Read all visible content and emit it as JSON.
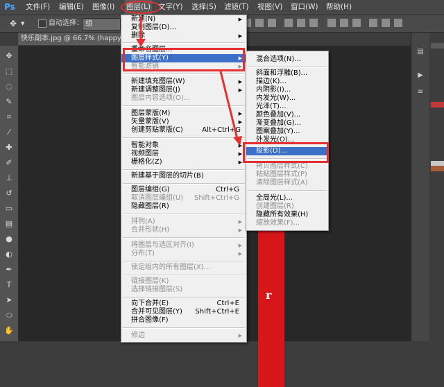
{
  "menubar": {
    "logo": "Ps",
    "items": [
      {
        "label": "文件(F)"
      },
      {
        "label": "编辑(E)"
      },
      {
        "label": "图像(I)"
      },
      {
        "label": "图层(L)"
      },
      {
        "label": "文字(Y)"
      },
      {
        "label": "选择(S)"
      },
      {
        "label": "滤镜(T)"
      },
      {
        "label": "视图(V)"
      },
      {
        "label": "窗口(W)"
      },
      {
        "label": "帮助(H)"
      }
    ]
  },
  "options_bar": {
    "auto_select_label": "自动选择：",
    "auto_select_value": "组"
  },
  "document_tab": {
    "title": "快乐副本.jpg @ 66.7% (happy"
  },
  "layer_menu": {
    "items": [
      {
        "label": "新建(N)",
        "arrow": "▶"
      },
      {
        "label": "复制图层(D)..."
      },
      {
        "label": "删除",
        "arrow": "▶"
      },
      {
        "label": "重命名图层..."
      },
      {
        "label": "图层样式(Y)",
        "arrow": "▶"
      },
      {
        "label": "智能滤镜",
        "arrow": "▶"
      },
      {
        "label": "新建填充图层(W)",
        "arrow": "▶"
      },
      {
        "label": "新建调整图层(J)",
        "arrow": "▶"
      },
      {
        "label": "图层内容选项(O)..."
      },
      {
        "label": "图层蒙版(M)",
        "arrow": "▶"
      },
      {
        "label": "矢量蒙版(V)",
        "arrow": "▶"
      },
      {
        "label": "创建剪贴蒙版(C)",
        "shortcut": "Alt+Ctrl+G"
      },
      {
        "label": "智能对象",
        "arrow": "▶"
      },
      {
        "label": "视频图层",
        "arrow": "▶"
      },
      {
        "label": "栅格化(Z)",
        "arrow": "▶"
      },
      {
        "label": "新建基于图层的切片(B)"
      },
      {
        "label": "图层编组(G)",
        "shortcut": "Ctrl+G"
      },
      {
        "label": "取消图层编组(U)",
        "shortcut": "Shift+Ctrl+G"
      },
      {
        "label": "隐藏图层(R)"
      },
      {
        "label": "排列(A)",
        "arrow": "▶"
      },
      {
        "label": "合并形状(H)",
        "arrow": "▶"
      },
      {
        "label": "将图层与选区对齐(I)",
        "arrow": "▶"
      },
      {
        "label": "分布(T)",
        "arrow": "▶"
      },
      {
        "label": "锁定组内的所有图层(X)..."
      },
      {
        "label": "链接图层(K)"
      },
      {
        "label": "选择链接图层(S)"
      },
      {
        "label": "向下合并(E)",
        "shortcut": "Ctrl+E"
      },
      {
        "label": "合并可见图层(Y)",
        "shortcut": "Shift+Ctrl+E"
      },
      {
        "label": "拼合图像(F)"
      },
      {
        "label": "修边",
        "arrow": "▶"
      }
    ]
  },
  "style_submenu": {
    "items": [
      {
        "label": "混合选项(N)..."
      },
      {
        "label": "斜面和浮雕(B)..."
      },
      {
        "label": "描边(K)..."
      },
      {
        "label": "内阴影(I)..."
      },
      {
        "label": "内发光(W)..."
      },
      {
        "label": "光泽(T)..."
      },
      {
        "label": "颜色叠加(V)..."
      },
      {
        "label": "渐变叠加(G)..."
      },
      {
        "label": "图案叠加(Y)..."
      },
      {
        "label": "外发光(O)..."
      },
      {
        "label": "投影(D)..."
      },
      {
        "label": "拷贝图层样式(C)"
      },
      {
        "label": "粘贴图层样式(P)"
      },
      {
        "label": "清除图层样式(A)"
      },
      {
        "label": "全局光(L)..."
      },
      {
        "label": "创建图层(R)"
      },
      {
        "label": "隐藏所有效果(H)"
      },
      {
        "label": "缩放效果(F)..."
      }
    ]
  },
  "canvas": {
    "red_text": "r"
  },
  "colors": {
    "annotation_red": "#e43030",
    "highlight_blue": "#3b6fc8",
    "image_red": "#d7161a"
  }
}
